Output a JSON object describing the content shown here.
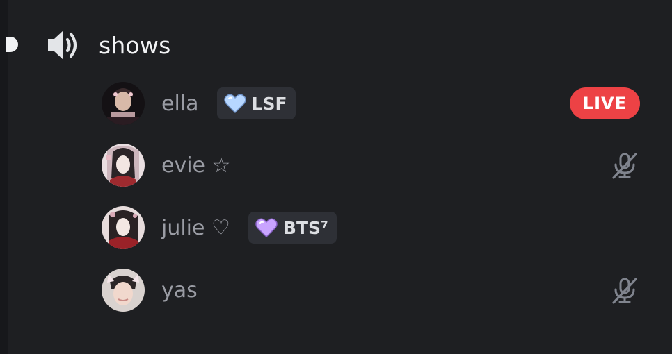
{
  "channel": {
    "name": "shows",
    "icon": "speaker-icon"
  },
  "users": [
    {
      "name": "ella",
      "badge": "LSF",
      "badge_icon": "light-blue-heart-icon",
      "status": "LIVE",
      "status_color": "#ed4245"
    },
    {
      "name": "evie ☆",
      "badge": "",
      "status": "muted",
      "status_icon": "muted-microphone-icon"
    },
    {
      "name": "julie ♡",
      "badge": "BTS⁷",
      "badge_icon": "purple-heart-icon",
      "status": ""
    },
    {
      "name": "yas",
      "badge": "",
      "status": "muted",
      "status_icon": "muted-microphone-icon"
    }
  ],
  "colors": {
    "background": "#1e1f22",
    "username": "#9a9ca4",
    "live": "#ed4245",
    "blue_heart": "#b7d7ff",
    "purple_heart": "#c9a4ff"
  }
}
